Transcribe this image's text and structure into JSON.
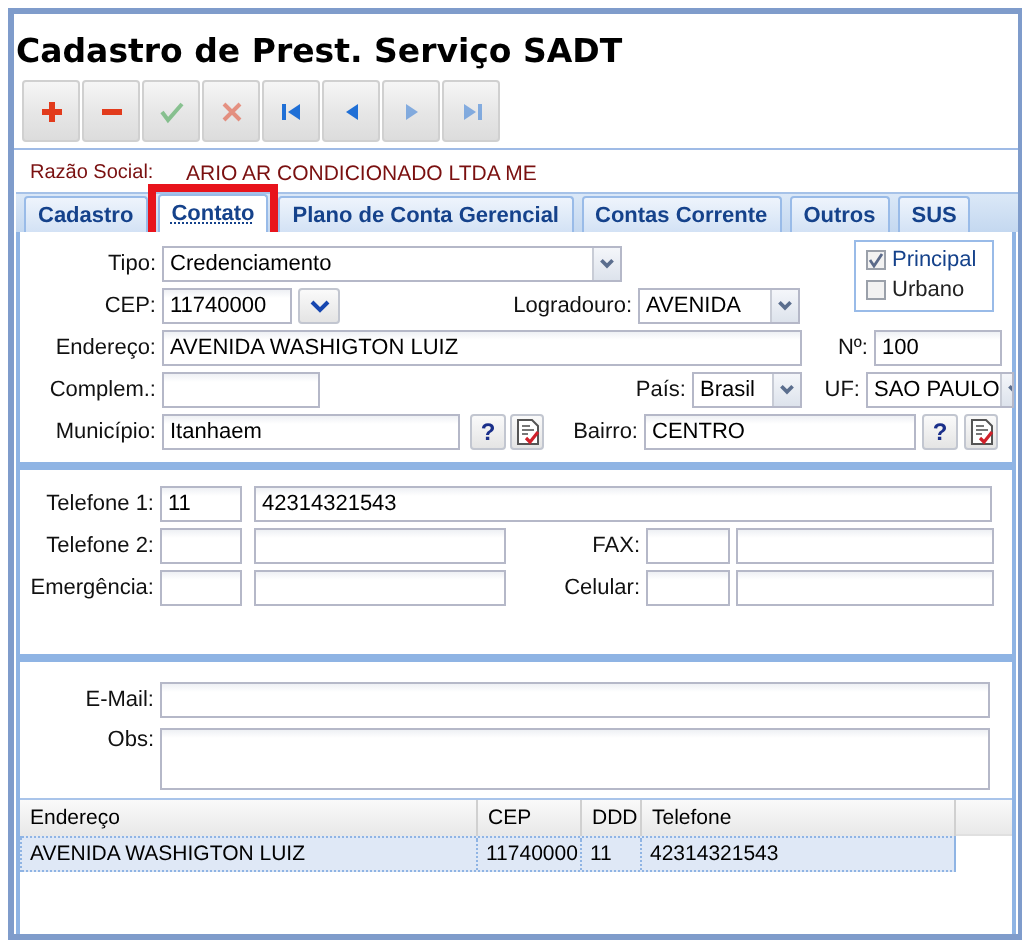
{
  "title": "Cadastro de Prest. Serviço SADT",
  "toolbar": [
    {
      "kind": "add",
      "disabled": false
    },
    {
      "kind": "remove",
      "disabled": false
    },
    {
      "kind": "confirm",
      "disabled": true
    },
    {
      "kind": "cancel",
      "disabled": true
    },
    {
      "kind": "first",
      "disabled": false
    },
    {
      "kind": "prev",
      "disabled": false
    },
    {
      "kind": "next",
      "disabled": true
    },
    {
      "kind": "last",
      "disabled": true
    }
  ],
  "razao_social": {
    "label": "Razão Social:",
    "value": "ARIO AR CONDICIONADO LTDA ME"
  },
  "tabs": [
    {
      "label": "Cadastro",
      "selected": false,
      "highlighted": false
    },
    {
      "label": "Contato",
      "selected": true,
      "highlighted": true
    },
    {
      "label": "Plano de Conta Gerencial",
      "selected": false,
      "highlighted": false
    },
    {
      "label": "Contas Corrente",
      "selected": false,
      "highlighted": false
    },
    {
      "label": "Outros",
      "selected": false,
      "highlighted": false
    },
    {
      "label": "SUS",
      "selected": false,
      "highlighted": false
    }
  ],
  "address": {
    "tipo": {
      "label": "Tipo:",
      "value": "Credenciamento"
    },
    "cep": {
      "label": "CEP:",
      "value": "11740000"
    },
    "logradouro": {
      "label": "Logradouro:",
      "value": "AVENIDA"
    },
    "endereco": {
      "label": "Endereço:",
      "value": "AVENIDA WASHIGTON LUIZ"
    },
    "numero": {
      "label": "Nº:",
      "value": "100"
    },
    "complemento": {
      "label": "Complem.:"
    },
    "pais": {
      "label": "País:",
      "value": "Brasil"
    },
    "uf": {
      "label": "UF:",
      "value": "SAO PAULO"
    },
    "municipio": {
      "label": "Município:",
      "value": "Itanhaem",
      "help": "?"
    },
    "bairro": {
      "label": "Bairro:",
      "value": "CENTRO",
      "help": "?"
    }
  },
  "flags": [
    {
      "label": "Principal",
      "checked": true
    },
    {
      "label": "Urbano",
      "checked": false
    }
  ],
  "phones": [
    {
      "label": "Telefone 1:",
      "ddd": "11",
      "number": "42314321543"
    },
    {
      "label": "Telefone 2:"
    },
    {
      "label": "FAX:"
    },
    {
      "label": "Emergência:"
    },
    {
      "label": "Celular:"
    }
  ],
  "email": {
    "label": "E-Mail:"
  },
  "obs": {
    "label": "Obs:"
  },
  "table": {
    "columns": [
      "Endereço",
      "CEP",
      "DDD",
      "Telefone"
    ],
    "rows": [
      {
        "cells": [
          "AVENIDA WASHIGTON LUIZ",
          "11740000",
          "11",
          "42314321543"
        ],
        "selected": true
      }
    ]
  }
}
